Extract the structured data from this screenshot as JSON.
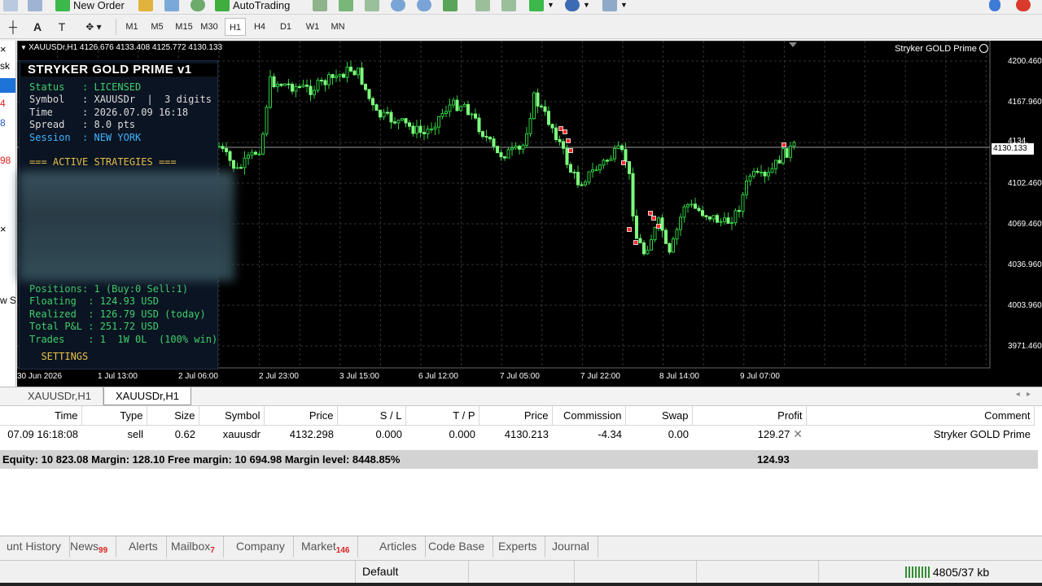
{
  "toolbar": {
    "new_order_label": "New Order",
    "autotrading_label": "AutoTrading",
    "timeframes": [
      "M1",
      "M5",
      "M15",
      "M30",
      "H1",
      "H4",
      "D1",
      "W1",
      "MN"
    ],
    "selected_timeframe": "H1"
  },
  "left_panel": {
    "fragments": [
      "sk",
      "4",
      "8",
      "98",
      "w S"
    ],
    "close_glyph": "×"
  },
  "chart": {
    "symbol_line": "XAUUSDr,H1  4126.676 4133.408 4125.772 4130.133",
    "ea_name": "Stryker GOLD Prime",
    "price_tag": "4130.133",
    "price_labels": [
      "4200.460",
      "4167.960",
      "4134.",
      "4102.460",
      "4069.460",
      "4036.960",
      "4003.960",
      "3971.460"
    ],
    "time_labels": [
      "30 Jun 2026",
      "1 Jul 13:00",
      "2 Jul 06:00",
      "2 Jul 23:00",
      "3 Jul 15:00",
      "6 Jul 12:00",
      "7 Jul 05:00",
      "7 Jul 22:00",
      "8 Jul 14:00",
      "9 Jul 07:00"
    ],
    "colors": {
      "bull": "#22dd22",
      "bear": "#7dff7d",
      "background": "#000000",
      "grid": "#3a3a3a"
    }
  },
  "info_panel": {
    "title": "STRYKER GOLD PRIME  v1",
    "status_label": "Status   : ",
    "status_value": "LICENSED",
    "symbol_row": "Symbol   : XAUUSDr  |  3 digits",
    "time_row": "Time     : 2026.07.09 16:18",
    "spread_row": "Spread   : 8.0 pts",
    "session_label": "Session  : ",
    "session_value": "NEW YORK",
    "strategies_header": "=== ACTIVE STRATEGIES ===",
    "positions_row": "Positions: 1 (Buy:0 Sell:1)",
    "floating_row": "Floating  : 124.93 USD",
    "realized_row": "Realized  : 126.79 USD (today)",
    "total_row": "Total P&L : 251.72 USD",
    "trades_row": "Trades    : 1  1W 0L  (100% win)",
    "settings_row": "  SETTINGS"
  },
  "chart_tabs": [
    "XAUUSDr,H1",
    "XAUUSDr,H1"
  ],
  "terminal": {
    "columns": [
      "Time",
      "Type",
      "Size",
      "Symbol",
      "Price",
      "S / L",
      "T / P",
      "Price",
      "Commission",
      "Swap",
      "Profit",
      "Comment"
    ],
    "rows": [
      [
        "07.09 16:18:08",
        "sell",
        "0.62",
        "xauusdr",
        "4132.298",
        "0.000",
        "0.000",
        "4130.213",
        "-4.34",
        "0.00",
        "129.27",
        "Stryker GOLD Prime"
      ]
    ],
    "summary_text": "Equity: 10 823.08  Margin: 128.10  Free margin: 10 694.98  Margin level: 8448.85%",
    "summary_profit": "124.93"
  },
  "bottom_tabs": [
    {
      "label": "unt History",
      "badge": ""
    },
    {
      "label": "News",
      "badge": "99"
    },
    {
      "label": "Alerts",
      "badge": ""
    },
    {
      "label": "Mailbox",
      "badge": "7"
    },
    {
      "label": "Company",
      "badge": ""
    },
    {
      "label": "Market",
      "badge": "146"
    },
    {
      "label": "Articles",
      "badge": ""
    },
    {
      "label": "Code Base",
      "badge": ""
    },
    {
      "label": "Experts",
      "badge": ""
    },
    {
      "label": "Journal",
      "badge": ""
    }
  ],
  "status_bar": {
    "profile": "Default",
    "traffic": "4805/37 kb"
  }
}
